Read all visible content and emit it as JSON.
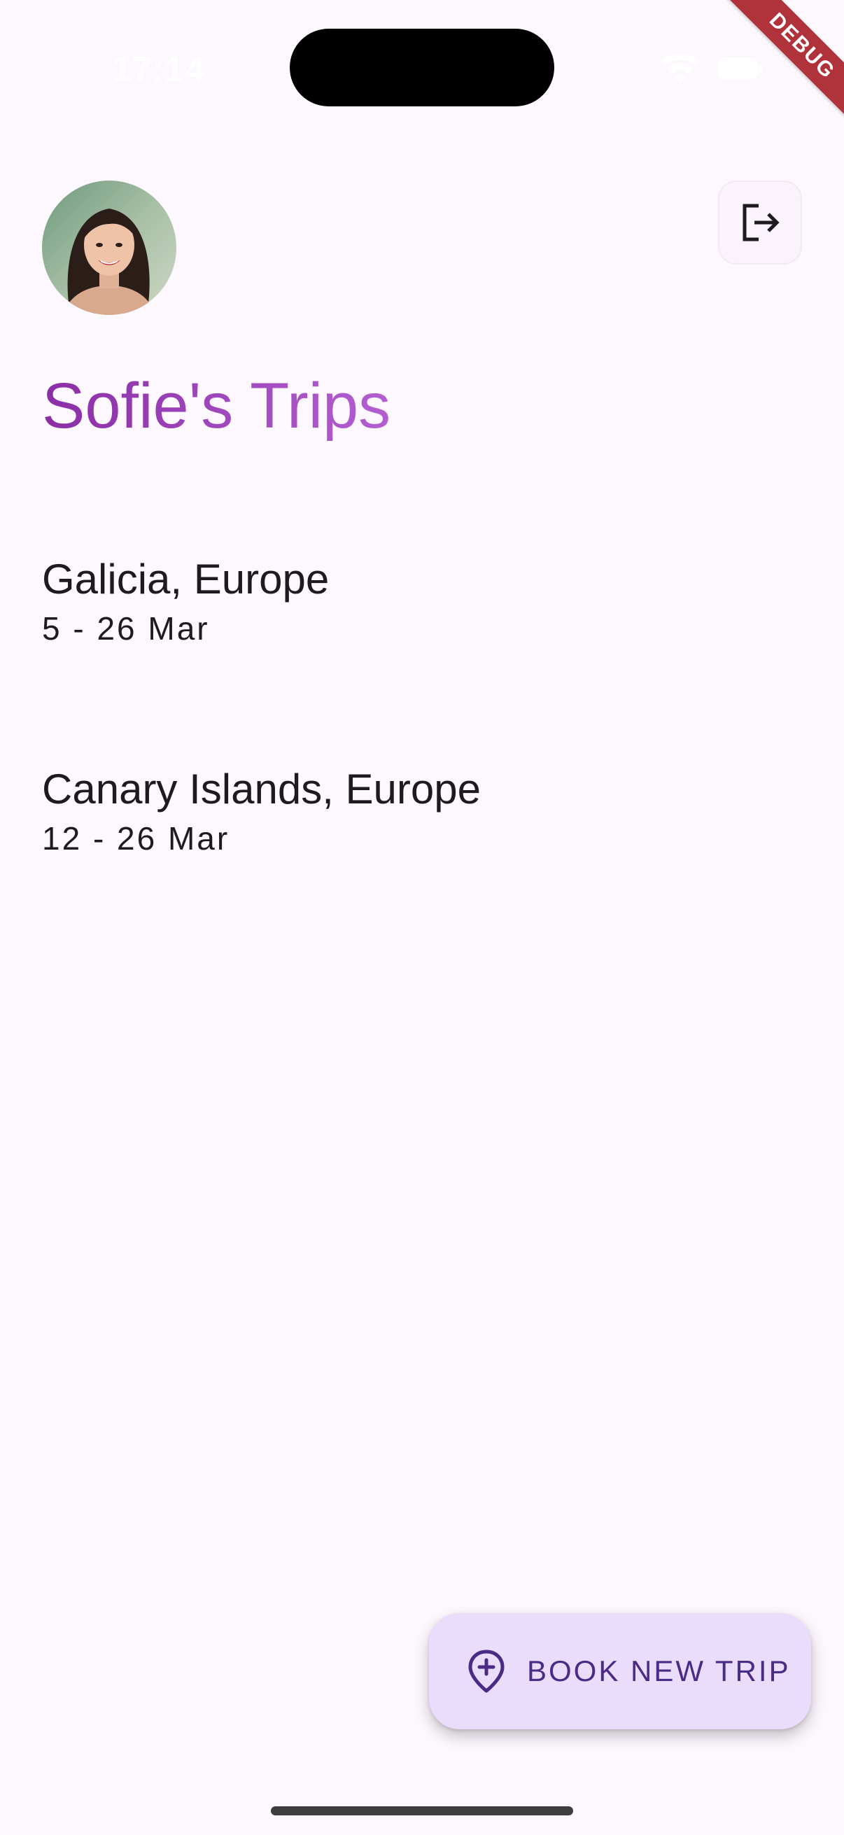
{
  "status_bar": {
    "time": "17:14"
  },
  "debug_banner": {
    "label": "DEBUG"
  },
  "header": {
    "avatar_icon": "user-avatar-photo",
    "logout_icon": "logout-icon"
  },
  "page": {
    "title": "Sofie's Trips"
  },
  "trips": [
    {
      "title": "Galicia, Europe",
      "dates": "5 - 26 Mar"
    },
    {
      "title": "Canary Islands, Europe",
      "dates": "12 - 26 Mar"
    }
  ],
  "fab": {
    "label": "BOOK NEW TRIP",
    "icon": "location-add-icon"
  },
  "colors": {
    "background": "#fdf7fe",
    "title_gradient_start": "#8a2ea6",
    "title_gradient_end": "#b35fd1",
    "fab_background": "#eadcfb",
    "fab_foreground": "#4a2b85",
    "debug_banner": "#b0323a"
  }
}
